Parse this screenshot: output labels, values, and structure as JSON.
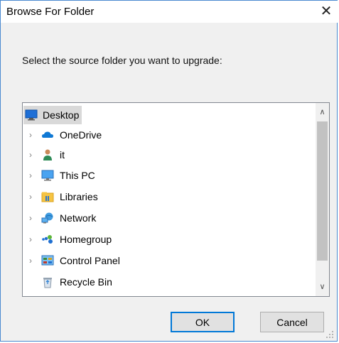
{
  "dialog": {
    "title": "Browse For Folder",
    "close_symbol": "✕",
    "prompt": "Select the source folder you want to upgrade:"
  },
  "tree": {
    "root": {
      "label": "Desktop",
      "icon": "desktop-icon",
      "selected": true
    },
    "items": [
      {
        "label": "OneDrive",
        "icon": "onedrive-icon",
        "expandable": true
      },
      {
        "label": "it",
        "icon": "user-icon",
        "expandable": true
      },
      {
        "label": "This PC",
        "icon": "computer-icon",
        "expandable": true
      },
      {
        "label": "Libraries",
        "icon": "libraries-icon",
        "expandable": true
      },
      {
        "label": "Network",
        "icon": "network-icon",
        "expandable": true
      },
      {
        "label": "Homegroup",
        "icon": "homegroup-icon",
        "expandable": true
      },
      {
        "label": "Control Panel",
        "icon": "control-panel-icon",
        "expandable": true
      },
      {
        "label": "Recycle Bin",
        "icon": "recycle-bin-icon",
        "expandable": false
      }
    ],
    "chevron_symbol": "›",
    "scroll_up_symbol": "∧",
    "scroll_down_symbol": "∨"
  },
  "buttons": {
    "ok_label": "OK",
    "cancel_label": "Cancel"
  },
  "colors": {
    "accent": "#0078d7",
    "selection": "#d9d9d9"
  }
}
